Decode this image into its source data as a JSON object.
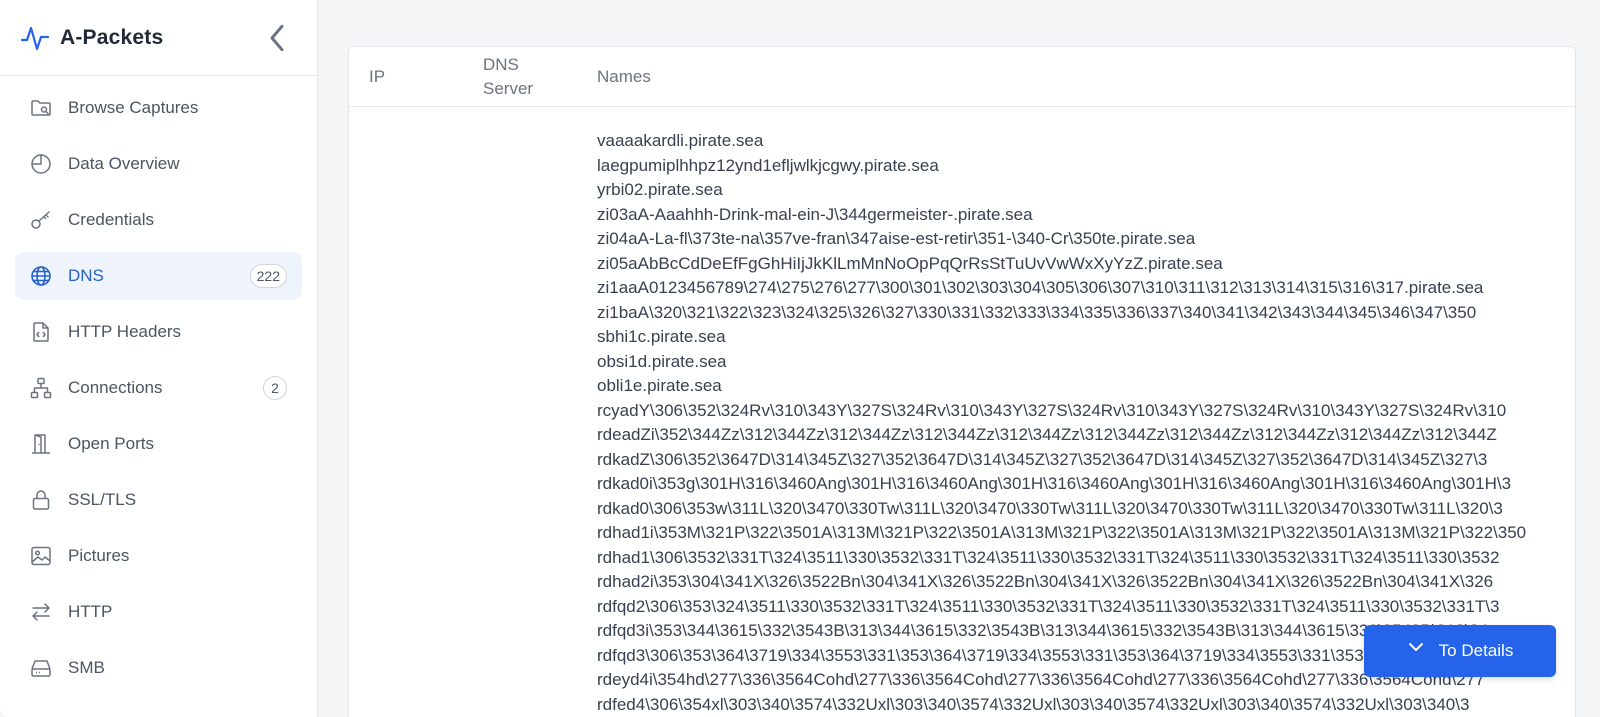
{
  "app": {
    "title": "A-Packets"
  },
  "sidebar": {
    "items": [
      {
        "label": "Browse Captures",
        "icon": "folder-search-icon"
      },
      {
        "label": "Data Overview",
        "icon": "pie-chart-icon"
      },
      {
        "label": "Credentials",
        "icon": "key-icon"
      },
      {
        "label": "DNS",
        "icon": "globe-icon",
        "badge": "222",
        "active": true
      },
      {
        "label": "HTTP Headers",
        "icon": "file-code-icon"
      },
      {
        "label": "Connections",
        "icon": "network-icon",
        "badge": "2"
      },
      {
        "label": "Open Ports",
        "icon": "door-icon"
      },
      {
        "label": "SSL/TLS",
        "icon": "lock-icon"
      },
      {
        "label": "Pictures",
        "icon": "image-icon"
      },
      {
        "label": "HTTP",
        "icon": "arrows-exchange-icon"
      },
      {
        "label": "SMB",
        "icon": "hard-drive-icon"
      }
    ]
  },
  "table": {
    "columns": {
      "ip": "IP",
      "dns_server": "DNS Server",
      "names": "Names"
    },
    "names": [
      "vaaaakardli.pirate.sea",
      "laegpumiplhhpz12ynd1efljwlkjcgwy.pirate.sea",
      "yrbi02.pirate.sea",
      "zi03aA-Aaahhh-Drink-mal-ein-J\\344germeister-.pirate.sea",
      "zi04aA-La-fl\\373te-na\\357ve-fran\\347aise-est-retir\\351-\\340-Cr\\350te.pirate.sea",
      "zi05aAbBcCdDeEfFgGhHiIjJkKlLmMnNoOpPqQrRsStTuUvVwWxXyYzZ.pirate.sea",
      "zi1aaA0123456789\\274\\275\\276\\277\\300\\301\\302\\303\\304\\305\\306\\307\\310\\311\\312\\313\\314\\315\\316\\317.pirate.sea",
      "zi1baA\\320\\321\\322\\323\\324\\325\\326\\327\\330\\331\\332\\333\\334\\335\\336\\337\\340\\341\\342\\343\\344\\345\\346\\347\\350",
      "sbhi1c.pirate.sea",
      "obsi1d.pirate.sea",
      "obli1e.pirate.sea",
      "rcyadY\\306\\352\\324Rv\\310\\343Y\\327S\\324Rv\\310\\343Y\\327S\\324Rv\\310\\343Y\\327S\\324Rv\\310\\343Y\\327S\\324Rv\\310",
      "rdeadZi\\352\\344Zz\\312\\344Zz\\312\\344Zz\\312\\344Zz\\312\\344Zz\\312\\344Zz\\312\\344Zz\\312\\344Zz\\312\\344Zz\\312\\344Z",
      "rdkadZ\\306\\352\\3647D\\314\\345Z\\327\\352\\3647D\\314\\345Z\\327\\352\\3647D\\314\\345Z\\327\\352\\3647D\\314\\345Z\\327\\3",
      "rdkad0i\\353g\\301H\\316\\3460Ang\\301H\\316\\3460Ang\\301H\\316\\3460Ang\\301H\\316\\3460Ang\\301H\\316\\3460Ang\\301H\\3",
      "rdkad0\\306\\353w\\311L\\320\\3470\\330Tw\\311L\\320\\3470\\330Tw\\311L\\320\\3470\\330Tw\\311L\\320\\3470\\330Tw\\311L\\320\\3",
      "rdhad1i\\353M\\321P\\322\\3501A\\313M\\321P\\322\\3501A\\313M\\321P\\322\\3501A\\313M\\321P\\322\\3501A\\313M\\321P\\322\\350",
      "rdhad1\\306\\3532\\331T\\324\\3511\\330\\3532\\331T\\324\\3511\\330\\3532\\331T\\324\\3511\\330\\3532\\331T\\324\\3511\\330\\3532",
      "rdhad2i\\353\\304\\341X\\326\\3522Bn\\304\\341X\\326\\3522Bn\\304\\341X\\326\\3522Bn\\304\\341X\\326\\3522Bn\\304\\341X\\326",
      "rdfqd2\\306\\353\\324\\3511\\330\\3532\\331T\\324\\3511\\330\\3532\\331T\\324\\3511\\330\\3532\\331T\\324\\3511\\330\\3532\\331T\\3",
      "rdfqd3i\\353\\344\\3615\\332\\3543B\\313\\344\\3615\\332\\3543B\\313\\344\\3615\\332\\3543B\\313\\344\\3615\\332\\3543B\\313\\34",
      "rdfqd3\\306\\353\\364\\3719\\334\\3553\\331\\353\\364\\3719\\334\\3553\\331\\353\\364\\3719\\334\\3553\\331\\353\\364\\3719\\334",
      "rdeyd4i\\354hd\\277\\336\\3564Cohd\\277\\336\\3564Cohd\\277\\336\\3564Cohd\\277\\336\\3564Cohd\\277\\336\\3564Cohd\\277",
      "rdfed4\\306\\354xl\\303\\340\\3574\\332Uxl\\303\\340\\3574\\332Uxl\\303\\340\\3574\\332Uxl\\303\\340\\3574\\332Uxl\\303\\340\\3"
    ]
  },
  "actions": {
    "to_details": "To Details"
  },
  "colors": {
    "accent": "#2563eb",
    "active_bg": "#eef3fc",
    "active_text": "#2563c9"
  }
}
